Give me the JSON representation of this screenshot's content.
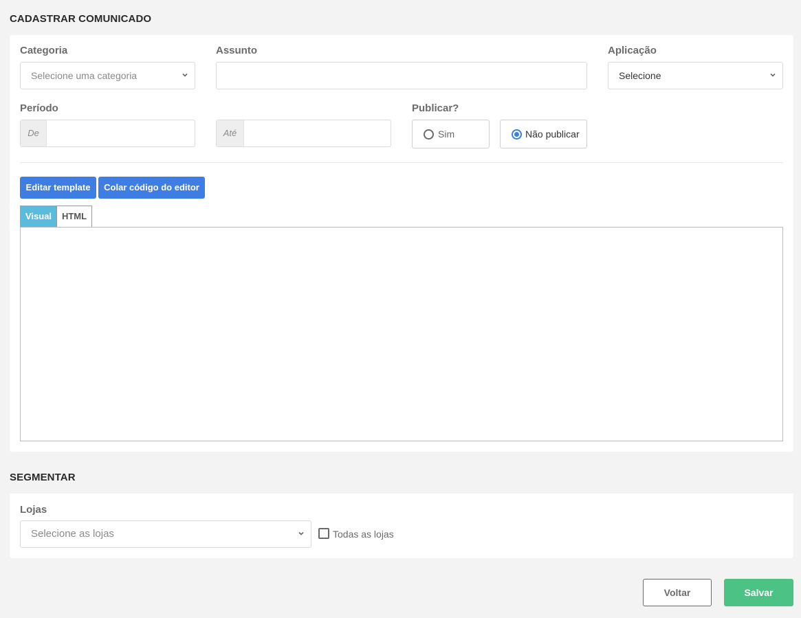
{
  "page": {
    "title": "CADASTRAR COMUNICADO"
  },
  "form": {
    "categoria": {
      "label": "Categoria",
      "placeholder": "Selecione uma categoria"
    },
    "assunto": {
      "label": "Assunto",
      "value": ""
    },
    "aplicacao": {
      "label": "Aplicação",
      "selected": "Selecione"
    },
    "periodo": {
      "label": "Período",
      "from_addon": "De",
      "to_addon": "Até",
      "from_value": "",
      "to_value": ""
    },
    "publicar": {
      "label": "Publicar?",
      "options": [
        {
          "label": "Sim",
          "selected": false
        },
        {
          "label": "Não publicar",
          "selected": true
        }
      ]
    }
  },
  "editor": {
    "buttons": {
      "edit_template": "Editar template",
      "paste_code": "Colar código do editor"
    },
    "tabs": [
      {
        "label": "Visual",
        "active": true
      },
      {
        "label": "HTML",
        "active": false
      }
    ],
    "content": ""
  },
  "segmentar": {
    "title": "SEGMENTAR",
    "lojas": {
      "label": "Lojas",
      "placeholder": "Selecione as lojas"
    },
    "todas": {
      "label": "Todas as lojas",
      "checked": false
    }
  },
  "actions": {
    "back": "Voltar",
    "save": "Salvar"
  },
  "colors": {
    "primary": "#3d7de4",
    "tab_active": "#5bbbdd",
    "success": "#4cc284",
    "background": "#f3f3f4"
  }
}
